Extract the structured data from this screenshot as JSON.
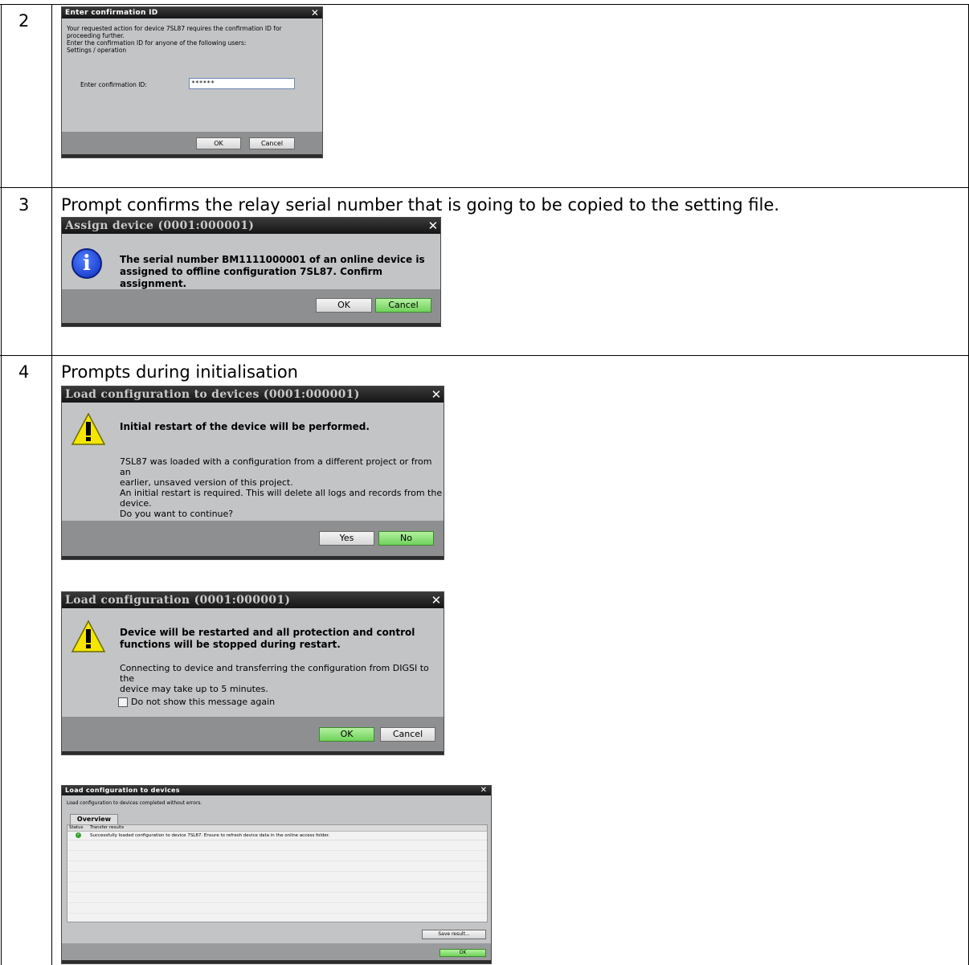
{
  "rows": [
    {
      "num": "2",
      "desc": ""
    },
    {
      "num": "3",
      "desc": "Prompt confirms the relay serial number that is going to be copied to the setting file."
    },
    {
      "num": "4",
      "desc": "Prompts during initialisation"
    }
  ],
  "dialog_confirm_id": {
    "title": "Enter confirmation ID",
    "message_lines": [
      "Your requested action for device 7SL87 requires the confirmation ID for",
      "proceeding further.",
      "Enter the confirmation ID for anyone of the following users:",
      "Settings / operation"
    ],
    "field_label": "Enter confirmation ID:",
    "field_value": "******",
    "ok_label": "OK",
    "cancel_label": "Cancel"
  },
  "dialog_assign": {
    "title": "Assign device (0001:000001)",
    "message_lines": [
      "The serial number BM1111000001 of an online device is",
      "assigned to offline configuration 7SL87. Confirm assignment."
    ],
    "ok_label": "OK",
    "cancel_label": "Cancel",
    "icon": "info-icon"
  },
  "dialog_load_devices": {
    "title": "Load configuration to devices (0001:000001)",
    "headline": "Initial restart of the device will be performed.",
    "message_lines": [
      "7SL87 was loaded with a configuration from a different project or from an",
      "earlier, unsaved version of this project.",
      "An initial restart is required. This will delete all logs and records from the",
      "device.",
      "Do you want to continue?"
    ],
    "yes_label": "Yes",
    "no_label": "No",
    "icon": "warning-icon"
  },
  "dialog_load_config": {
    "title": "Load configuration (0001:000001)",
    "headline_lines": [
      "Device will be restarted and all protection and control",
      "functions will be stopped during restart."
    ],
    "message_lines": [
      "Connecting to device and transferring the configuration from DIGSI to the",
      "device may take up to 5 minutes."
    ],
    "checkbox_label": "Do not show this message again",
    "ok_label": "OK",
    "cancel_label": "Cancel",
    "icon": "warning-icon"
  },
  "dialog_results": {
    "title": "Load configuration to devices",
    "summary": "Load configuration to devices completed without errors.",
    "tab_label": "Overview",
    "columns": [
      "Status",
      "Transfer results"
    ],
    "rows": [
      {
        "status": "success",
        "text": "Successfully loaded configuration to device 7SL87. Ensure to refresh device data in the online access folder."
      }
    ],
    "save_label": "Save result...",
    "ok_label": "OK"
  }
}
